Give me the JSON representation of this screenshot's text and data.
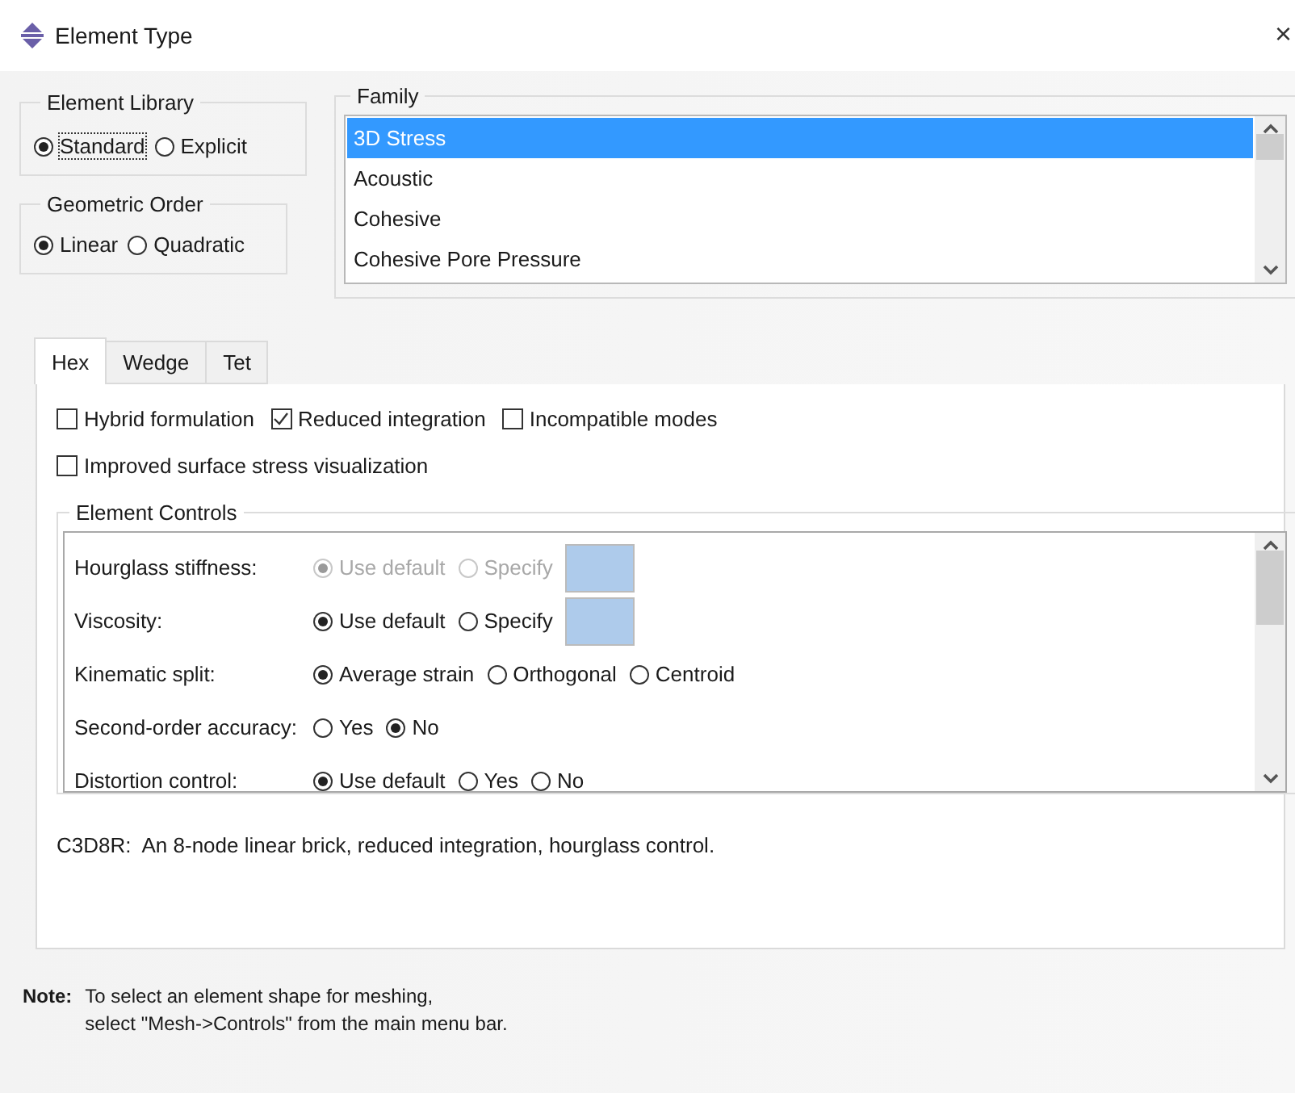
{
  "window": {
    "title": "Element Type",
    "close": "×"
  },
  "element_library": {
    "title": "Element Library",
    "options": [
      {
        "label": "Standard",
        "selected": true,
        "focused": true
      },
      {
        "label": "Explicit",
        "selected": false,
        "focused": false
      }
    ]
  },
  "geometric_order": {
    "title": "Geometric Order",
    "options": [
      {
        "label": "Linear",
        "selected": true
      },
      {
        "label": "Quadratic",
        "selected": false
      }
    ]
  },
  "family": {
    "title": "Family",
    "items": [
      {
        "label": "3D Stress",
        "selected": true
      },
      {
        "label": "Acoustic",
        "selected": false
      },
      {
        "label": "Cohesive",
        "selected": false
      },
      {
        "label": "Cohesive Pore Pressure",
        "selected": false
      }
    ]
  },
  "tabs": [
    {
      "label": "Hex",
      "selected": true
    },
    {
      "label": "Wedge",
      "selected": false
    },
    {
      "label": "Tet",
      "selected": false
    }
  ],
  "checkbox_rows": [
    [
      {
        "label": "Hybrid formulation",
        "checked": false
      },
      {
        "label": "Reduced integration",
        "checked": true
      },
      {
        "label": "Incompatible modes",
        "checked": false
      }
    ],
    [
      {
        "label": "Improved surface stress visualization",
        "checked": false
      }
    ]
  ],
  "element_controls": {
    "title": "Element Controls",
    "rows": [
      {
        "label": "Hourglass stiffness:",
        "disabled": true,
        "has_field": true,
        "options": [
          {
            "label": "Use default",
            "selected": true
          },
          {
            "label": "Specify",
            "selected": false
          }
        ]
      },
      {
        "label": "Viscosity:",
        "disabled": false,
        "has_field": true,
        "options": [
          {
            "label": "Use default",
            "selected": true
          },
          {
            "label": "Specify",
            "selected": false
          }
        ]
      },
      {
        "label": "Kinematic split:",
        "disabled": false,
        "has_field": false,
        "options": [
          {
            "label": "Average strain",
            "selected": true
          },
          {
            "label": "Orthogonal",
            "selected": false
          },
          {
            "label": "Centroid",
            "selected": false
          }
        ]
      },
      {
        "label": "Second-order accuracy:",
        "disabled": false,
        "has_field": false,
        "options": [
          {
            "label": "Yes",
            "selected": false
          },
          {
            "label": "No",
            "selected": true
          }
        ]
      },
      {
        "label": "Distortion control:",
        "disabled": false,
        "has_field": false,
        "options": [
          {
            "label": "Use default",
            "selected": true
          },
          {
            "label": "Yes",
            "selected": false
          },
          {
            "label": "No",
            "selected": false
          }
        ]
      }
    ]
  },
  "description": "C3D8R:  An 8-node linear brick, reduced integration, hourglass control.",
  "note": {
    "label": "Note:",
    "lines": [
      "To select an element shape for meshing,",
      "select \"Mesh->Controls\" from the main menu bar."
    ]
  }
}
